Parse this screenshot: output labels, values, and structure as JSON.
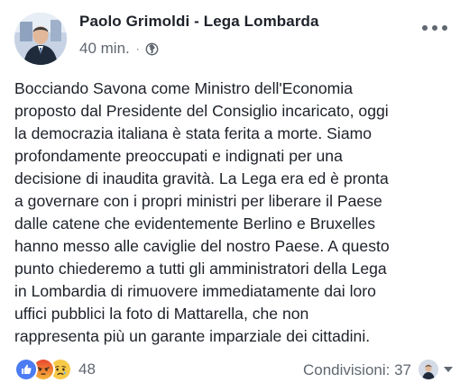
{
  "header": {
    "author": "Paolo Grimoldi - Lega Lombarda",
    "time": "40 min.",
    "separator": "·",
    "privacy_icon": "globe-icon",
    "more_icon": "more-options-icon"
  },
  "post": {
    "lines": [
      "Bocciando Savona come Ministro dell'Economia",
      "proposto dal Presidente del Consiglio incaricato, oggi",
      "la democrazia italiana è stata ferita a morte. Siamo",
      "profondamente preoccupati e indignati per una",
      "decisione di inaudita gravità. La Lega era ed è pronta",
      "a governare con i propri ministri per liberare il Paese",
      "dalle catene che evidentemente Berlino e Bruxelles",
      "hanno messo alle caviglie del nostro Paese. A questo",
      "punto chiederemo a tutti gli amministratori della Lega",
      "in Lombardia di rimuovere immediatamente dai loro",
      "uffici pubblici la foto di Mattarella, che non",
      "rappresenta più un garante imparziale dei cittadini."
    ]
  },
  "footer": {
    "reactions": [
      "like-reaction-icon",
      "angry-reaction-icon",
      "sad-reaction-icon"
    ],
    "reaction_count": "48",
    "shares": "Condivisioni: 37",
    "colors": {
      "like": "#4c7cf3",
      "angry": "#e9710f",
      "sad": "#f7c949",
      "meta_text": "#606770"
    }
  }
}
